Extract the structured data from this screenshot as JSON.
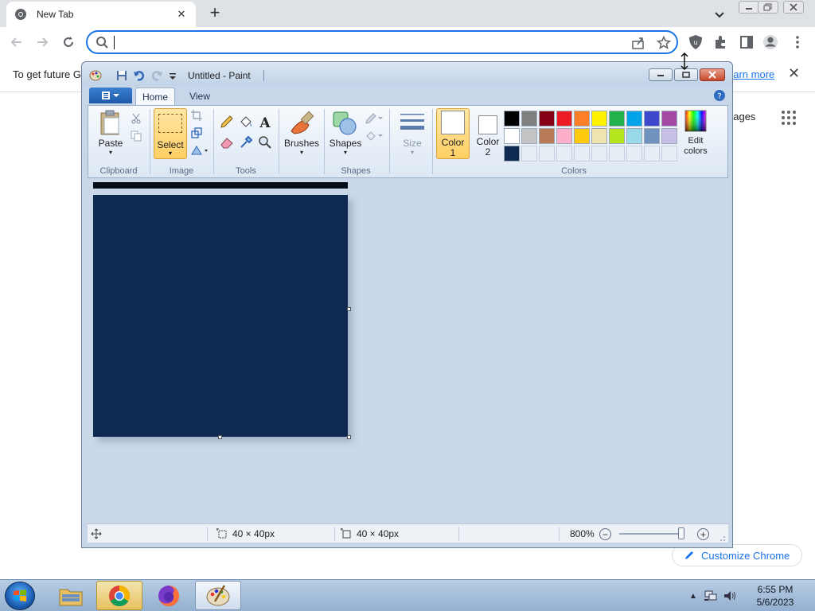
{
  "chrome": {
    "tab": {
      "title": "New Tab",
      "close": "✕"
    },
    "new_tab": "+",
    "omnibox": {
      "value": "",
      "placeholder": ""
    },
    "infobar": {
      "text": "To get future G",
      "link": "earn more",
      "close": "✕"
    },
    "page": {
      "images_link": "nages",
      "customize_label": "Customize Chrome"
    },
    "colors": {
      "accent": "#1a73e8",
      "tabstrip": "#dee1e6"
    }
  },
  "paint": {
    "title": "Untitled - Paint",
    "tabs": [
      {
        "label": "Home",
        "active": true
      },
      {
        "label": "View",
        "active": false
      }
    ],
    "groups": {
      "clipboard": "Clipboard",
      "image": "Image",
      "tools": "Tools",
      "shapes": "Shapes",
      "colors": "Colors"
    },
    "buttons": {
      "paste": "Paste",
      "select": "Select",
      "brushes": "Brushes",
      "shapes": "Shapes",
      "size": "Size",
      "color1_line1": "Color",
      "color1_line2": "1",
      "color2_line1": "Color",
      "color2_line2": "2",
      "edit_colors_line1": "Edit",
      "edit_colors_line2": "colors"
    },
    "palette": [
      "#000000",
      "#7f7f7f",
      "#880015",
      "#ed1c24",
      "#ff7f27",
      "#fff200",
      "#22b14c",
      "#00a2e8",
      "#3f48cc",
      "#a349a4",
      "#ffffff",
      "#c3c3c3",
      "#b97a57",
      "#ffaec9",
      "#ffc90e",
      "#efe4b0",
      "#b5e61d",
      "#99d9ea",
      "#7092be",
      "#c8bfe7",
      "#0e2a50",
      "",
      "",
      "",
      "",
      "",
      "",
      "",
      "",
      ""
    ],
    "color1": "#ffffff",
    "color2": "#ffffff",
    "canvas_color": "#0e2a50",
    "status": {
      "selection_size": "40 × 40px",
      "image_size": "40 × 40px",
      "zoom": "800%",
      "zoom_level_fraction": 0.97
    }
  },
  "taskbar": {
    "apps": [
      {
        "name": "windows-explorer",
        "active": false
      },
      {
        "name": "google-chrome",
        "active": false
      },
      {
        "name": "firefox",
        "active": false
      },
      {
        "name": "paint",
        "active": true
      }
    ],
    "clock": {
      "time": "6:55 PM",
      "date": "5/6/2023"
    }
  }
}
